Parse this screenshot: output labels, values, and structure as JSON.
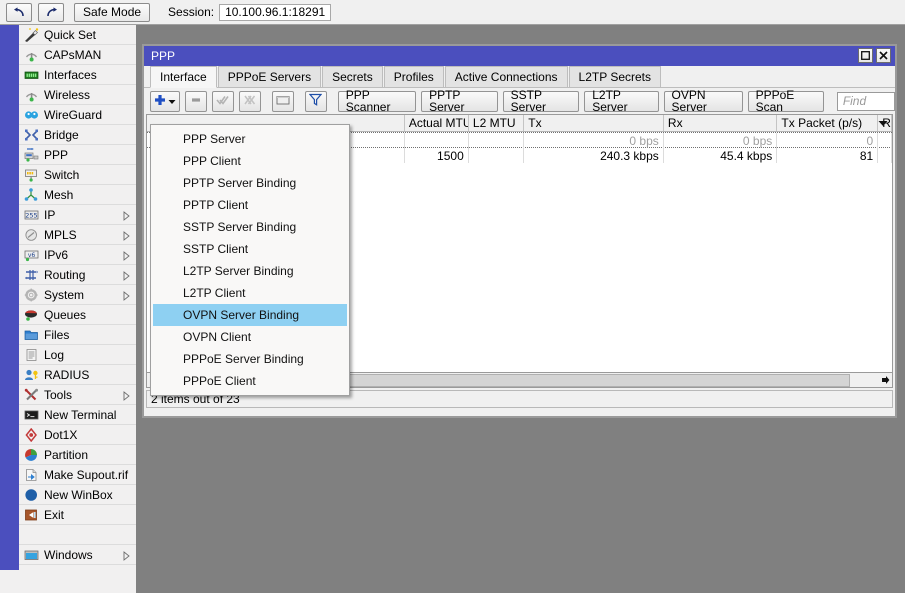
{
  "toolbar": {
    "undo_icon": "undo-arrow-icon",
    "redo_icon": "redo-arrow-icon",
    "safe_mode_label": "Safe Mode",
    "session_label": "Session:",
    "session_value": "10.100.96.1:18291"
  },
  "sidebar": {
    "items": [
      {
        "label": "Quick Set",
        "icon": "wand-icon",
        "arrow": false
      },
      {
        "label": "CAPsMAN",
        "icon": "antenna-icon",
        "arrow": false
      },
      {
        "label": "Interfaces",
        "icon": "nic-card-icon",
        "arrow": false
      },
      {
        "label": "Wireless",
        "icon": "antenna-icon",
        "arrow": false
      },
      {
        "label": "WireGuard",
        "icon": "wireguard-icon",
        "arrow": false
      },
      {
        "label": "Bridge",
        "icon": "bridge-icon",
        "arrow": false
      },
      {
        "label": "PPP",
        "icon": "ppp-icon",
        "arrow": false
      },
      {
        "label": "Switch",
        "icon": "switch-icon",
        "arrow": false
      },
      {
        "label": "Mesh",
        "icon": "mesh-icon",
        "arrow": false
      },
      {
        "label": "IP",
        "icon": "ip-255-icon",
        "arrow": true
      },
      {
        "label": "MPLS",
        "icon": "mpls-icon",
        "arrow": true
      },
      {
        "label": "IPv6",
        "icon": "ipv6-icon",
        "arrow": true
      },
      {
        "label": "Routing",
        "icon": "routing-icon",
        "arrow": true
      },
      {
        "label": "System",
        "icon": "gear-icon",
        "arrow": true
      },
      {
        "label": "Queues",
        "icon": "queues-icon",
        "arrow": false
      },
      {
        "label": "Files",
        "icon": "folder-icon",
        "arrow": false
      },
      {
        "label": "Log",
        "icon": "log-icon",
        "arrow": false
      },
      {
        "label": "RADIUS",
        "icon": "radius-icon",
        "arrow": false
      },
      {
        "label": "Tools",
        "icon": "tools-icon",
        "arrow": true
      },
      {
        "label": "New Terminal",
        "icon": "terminal-icon",
        "arrow": false
      },
      {
        "label": "Dot1X",
        "icon": "dot1x-icon",
        "arrow": false
      },
      {
        "label": "Partition",
        "icon": "partition-icon",
        "arrow": false
      },
      {
        "label": "Make Supout.rif",
        "icon": "supout-icon",
        "arrow": false
      },
      {
        "label": "New WinBox",
        "icon": "winbox-icon",
        "arrow": false
      },
      {
        "label": "Exit",
        "icon": "exit-icon",
        "arrow": false
      }
    ],
    "windows_item": {
      "label": "Windows",
      "icon": "window-icon",
      "arrow": true
    }
  },
  "window": {
    "title": "PPP",
    "maximize_icon": "maximize-icon",
    "close_icon": "close-icon",
    "tabs": [
      {
        "label": "Interface",
        "active": true
      },
      {
        "label": "PPPoE Servers",
        "active": false
      },
      {
        "label": "Secrets",
        "active": false
      },
      {
        "label": "Profiles",
        "active": false
      },
      {
        "label": "Active Connections",
        "active": false
      },
      {
        "label": "L2TP Secrets",
        "active": false
      }
    ],
    "toolbar": {
      "add_icon": "plus-icon",
      "add_dropdown_icon": "chevron-down-icon",
      "remove_icon": "minus-icon",
      "enable_icon": "check-icon",
      "disable_icon": "cross-icon",
      "comment_icon": "comment-icon",
      "filter_icon": "filter-icon",
      "buttons": [
        "PPP Scanner",
        "PPTP Server",
        "SSTP Server",
        "L2TP Server",
        "OVPN Server",
        "PPPoE Scan"
      ],
      "find_placeholder": "Find"
    },
    "table": {
      "columns": [
        "",
        "Actual MTU",
        "L2 MTU",
        "Tx",
        "Rx",
        "Tx Packet (p/s)",
        "R"
      ],
      "dropdown_icon": "column-chooser-icon",
      "rows": [
        {
          "focused": true,
          "cells": [
            "",
            "",
            "",
            "0 bps",
            "0 bps",
            "0",
            ""
          ],
          "dim": true
        },
        {
          "focused": false,
          "cells": [
            "",
            "1500",
            "",
            "240.3 kbps",
            "45.4 kbps",
            "81",
            ""
          ],
          "dim": false
        }
      ]
    },
    "scrollbar": {
      "left_arrow_icon": "arrow-left-icon",
      "right_arrow_icon": "arrow-right-icon"
    },
    "status": "2 items out of 23"
  },
  "dropdown_menu": {
    "items": [
      {
        "label": "PPP Server",
        "selected": false
      },
      {
        "label": "PPP Client",
        "selected": false
      },
      {
        "label": "PPTP Server Binding",
        "selected": false
      },
      {
        "label": "PPTP Client",
        "selected": false
      },
      {
        "label": "SSTP Server Binding",
        "selected": false
      },
      {
        "label": "SSTP Client",
        "selected": false
      },
      {
        "label": "L2TP Server Binding",
        "selected": false
      },
      {
        "label": "L2TP Client",
        "selected": false
      },
      {
        "label": "OVPN Server Binding",
        "selected": true
      },
      {
        "label": "OVPN Client",
        "selected": false
      },
      {
        "label": "PPPoE Server Binding",
        "selected": false
      },
      {
        "label": "PPPoE Client",
        "selected": false
      }
    ]
  },
  "colors": {
    "accent": "#4b4fbe",
    "selection": "#8ed0f2",
    "desktop": "#808080",
    "chrome": "#f0f0f0"
  }
}
